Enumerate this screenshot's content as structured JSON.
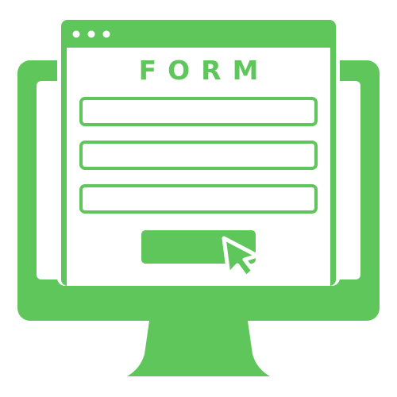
{
  "window": {
    "title": "FORM"
  },
  "colors": {
    "accent": "#5ec65b",
    "background": "#ffffff"
  },
  "icons": {
    "monitor": "monitor-icon",
    "window_dots": "window-dots-icon",
    "cursor": "cursor-arrow-icon"
  },
  "form": {
    "fields": [
      {
        "value": ""
      },
      {
        "value": ""
      },
      {
        "value": ""
      }
    ],
    "submit_label": ""
  }
}
